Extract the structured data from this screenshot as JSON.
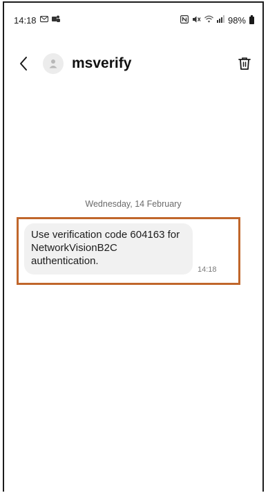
{
  "status_bar": {
    "time": "14:18",
    "battery": "98%"
  },
  "header": {
    "contact_name": "msverify"
  },
  "conversation": {
    "date_separator": "Wednesday, 14 February",
    "messages": [
      {
        "text": "Use verification code 604163 for NetworkVisionB2C authentication.",
        "time": "14:18"
      }
    ]
  },
  "colors": {
    "highlight_border": "#c0662b",
    "bubble_bg": "#f1f1f1",
    "avatar_bg": "#ececec"
  },
  "icons": {
    "back": "chevron-left-icon",
    "avatar": "person-icon",
    "delete": "trash-icon"
  }
}
